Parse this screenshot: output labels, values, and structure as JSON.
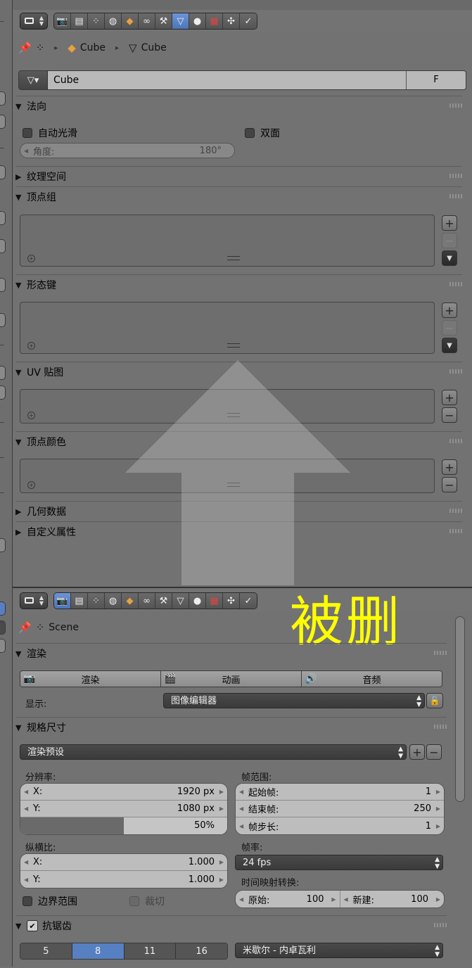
{
  "properties_top": {
    "breadcrumb": {
      "object_name": "Cube",
      "mesh_name": "Cube"
    },
    "datablock": {
      "name": "Cube",
      "fake_user": "F"
    },
    "panels": {
      "normals": {
        "title": "法向",
        "auto_smooth": "自动光滑",
        "double_sided": "双面",
        "angle_label": "角度:",
        "angle_value": "180°"
      },
      "texture_space": {
        "title": "纹理空间"
      },
      "vertex_groups": {
        "title": "顶点组"
      },
      "shape_keys": {
        "title": "形态键"
      },
      "uv_maps": {
        "title": "UV 贴图"
      },
      "vertex_colors": {
        "title": "顶点颜色"
      },
      "geometry_data": {
        "title": "几何数据"
      },
      "custom_props": {
        "title": "自定义属性"
      }
    }
  },
  "properties_bottom": {
    "breadcrumb": {
      "scene_name": "Scene"
    },
    "annotation": "被删",
    "render_panel": {
      "title": "渲染",
      "buttons": {
        "render": "渲染",
        "animation": "动画",
        "audio": "音频"
      },
      "display_label": "显示:",
      "display_value": "图像编辑器"
    },
    "dimensions_panel": {
      "title": "规格尺寸",
      "preset": "渲染预设",
      "resolution_label": "分辨率:",
      "res_x_label": "X:",
      "res_x_value": "1920 px",
      "res_y_label": "Y:",
      "res_y_value": "1080 px",
      "res_percent": "50%",
      "res_percent_fraction": 0.5,
      "aspect_label": "纵横比:",
      "aspect_x_label": "X:",
      "aspect_x_value": "1.000",
      "aspect_y_label": "Y:",
      "aspect_y_value": "1.000",
      "border": "边界范围",
      "crop": "裁切",
      "frame_range_label": "帧范围:",
      "start_label": "起始帧:",
      "start_value": "1",
      "end_label": "结束帧:",
      "end_value": "250",
      "step_label": "帧步长:",
      "step_value": "1",
      "fps_label": "帧率:",
      "fps_value": "24 fps",
      "time_remap_label": "时间映射转换:",
      "old_label": "原始:",
      "old_value": "100",
      "new_label": "新建:",
      "new_value": "100"
    },
    "antialias_panel": {
      "title": "抗锯齿",
      "samples": [
        "5",
        "8",
        "11",
        "16"
      ],
      "selected_sample": "8",
      "filter": "米歇尔 - 内卓瓦利"
    }
  },
  "icons": {
    "editor_type": "properties-editor-icon",
    "tabs": [
      "render-icon",
      "render-layers-icon",
      "scene-icon",
      "world-icon",
      "object-icon",
      "constraints-icon",
      "modifiers-icon",
      "data-icon",
      "material-icon",
      "texture-icon",
      "particles-icon",
      "physics-icon"
    ]
  },
  "colors": {
    "accent": "#5680c2",
    "annotation": "#ffff00",
    "panel_bg": "#727272"
  }
}
